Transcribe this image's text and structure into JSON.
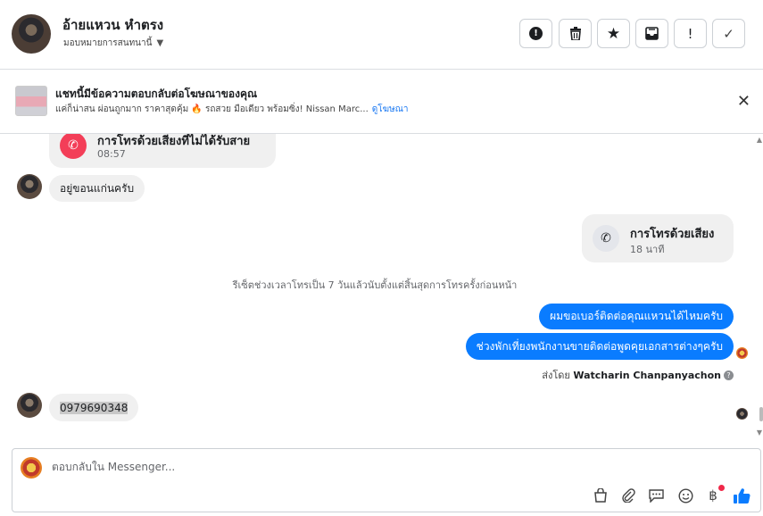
{
  "header": {
    "contact_name": "อ้ายแหวน หำตรง",
    "assign_label": "มอบหมายการสนทนานี้",
    "actions": [
      {
        "name": "report-spam-button",
        "icon": "alert-circle-icon",
        "glyph": "!"
      },
      {
        "name": "delete-button",
        "icon": "trash-icon",
        "glyph": "🗑"
      },
      {
        "name": "star-button",
        "icon": "star-icon",
        "glyph": "★"
      },
      {
        "name": "archive-button",
        "icon": "archive-icon",
        "glyph": "⊠"
      },
      {
        "name": "mark-follow-up-button",
        "icon": "exclamation-icon",
        "glyph": "!"
      },
      {
        "name": "mark-done-button",
        "icon": "check-icon",
        "glyph": "✓"
      }
    ]
  },
  "ad_banner": {
    "title": "แชทนี้มีข้อความตอบกลับต่อโฆษณาของคุณ",
    "snippet": "แค่ก็น่าสน ผ่อนถูกมาก ราคาสุดคุ้ม 🔥 รถสวย มือเดียว พร้อมซิ่ง! Nissan Marc...",
    "link": "ดูโฆษณา"
  },
  "messages": {
    "missed_call_title": "การโทรด้วยเสียงที่ไม่ได้รับสาย",
    "missed_call_time": "08:57",
    "incoming_1": "อยู่ขอนแก่นครับ",
    "voice_call_title": "การโทรด้วยเสียง",
    "voice_call_duration": "18 นาที",
    "system_note": "รีเซ็ตช่วงเวลาโทรเป็น 7 วันแล้วนับตั้งแต่สิ้นสุดการโทรครั้งก่อนหน้า",
    "outgoing_1": "ผมขอเบอร์ติดต่อคุณแหวนได้ไหมครับ",
    "outgoing_2": "ช่วงพักเที่ยงพนักงานขายติดต่อพูดคุยเอกสารต่างๆครับ",
    "sent_by_label": "ส่งโดย",
    "sent_by_name": "Watcharin Chanpanyachon",
    "incoming_2": "0979690348"
  },
  "composer": {
    "placeholder": "ตอบกลับใน Messenger...",
    "tools": [
      "shop-icon",
      "attachment-icon",
      "saved-reply-icon",
      "emoji-icon",
      "payment-baht-icon",
      "like-icon"
    ]
  },
  "colors": {
    "accent": "#0a7cff",
    "missed_call": "#f33e58",
    "bubble_in": "#f0f0f0",
    "link": "#1877f2"
  }
}
